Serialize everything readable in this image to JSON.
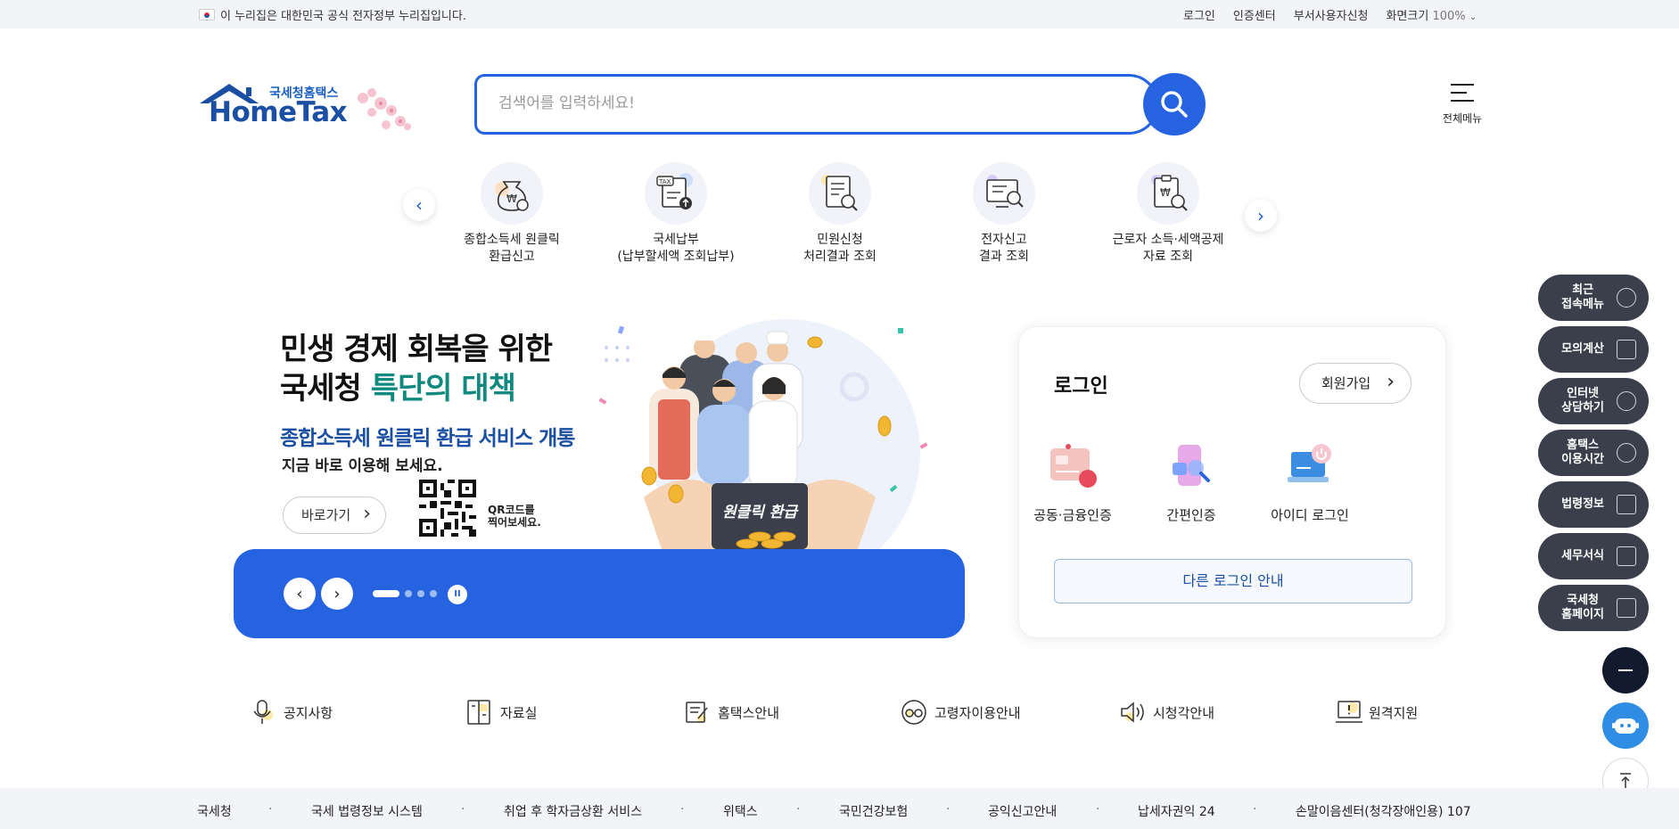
{
  "topbar": {
    "gov_notice": "이 누리집은 대한민국 공식 전자정부 누리집입니다.",
    "links": [
      "로그인",
      "인증센터",
      "부서사용자신청"
    ],
    "zoom_label": "화면크기",
    "zoom_value": "100%"
  },
  "header": {
    "logo_sub": "국세청홈택스",
    "logo_main": "HomeTax",
    "search_placeholder": "검색어를 입력하세요!",
    "menu_label": "전체메뉴"
  },
  "quick_menu": [
    {
      "line1": "종합소득세 원클릭",
      "line2": "환급신고",
      "icon": "money-bag-icon"
    },
    {
      "line1": "국세납부",
      "line2": "(납부할세액 조회납부)",
      "icon": "tax-document-icon"
    },
    {
      "line1": "민원신청",
      "line2": "처리결과 조회",
      "icon": "document-search-icon"
    },
    {
      "line1": "전자신고",
      "line2": "결과 조회",
      "icon": "monitor-search-icon"
    },
    {
      "line1": "근로자 소득·세액공제",
      "line2": "자료 조회",
      "icon": "clipboard-search-icon"
    }
  ],
  "banner": {
    "title_line1": "민생 경제 회복을 위한",
    "title_line2_plain": "국세청 ",
    "title_line2_highlight": "특단의 대책",
    "subtitle": "종합소득세 원클릭 환급 서비스 개통",
    "subtitle2": "지금 바로 이용해 보세요.",
    "go_button": "바로가기",
    "qr_text_line1": "QR코드를",
    "qr_text_line2": "찍어보세요.",
    "sign_text": "원클릭 환급",
    "slide_count": 4,
    "active_slide": 1
  },
  "login": {
    "title": "로그인",
    "join_button": "회원가입",
    "options": [
      "공동·금융인증",
      "간편인증",
      "아이디 로그인"
    ],
    "other_button": "다른 로그인 안내"
  },
  "side_menu": [
    {
      "line1": "최근",
      "line2": "접속메뉴",
      "icon": "clock-icon"
    },
    {
      "line1": "모의계산",
      "line2": "",
      "icon": "calculator-icon"
    },
    {
      "line1": "인터넷",
      "line2": "상담하기",
      "icon": "chat-icon"
    },
    {
      "line1": "홈택스",
      "line2": "이용시간",
      "icon": "alarm-clock-icon"
    },
    {
      "line1": "법령정보",
      "line2": "",
      "icon": "gavel-icon"
    },
    {
      "line1": "세무서식",
      "line2": "",
      "icon": "form-icon"
    },
    {
      "line1": "국세청",
      "line2": "홈페이지",
      "icon": "building-icon"
    }
  ],
  "services": [
    {
      "label": "공지사항",
      "icon": "microphone-icon"
    },
    {
      "label": "자료실",
      "icon": "cabinet-icon"
    },
    {
      "label": "홈택스안내",
      "icon": "note-icon"
    },
    {
      "label": "고령자이용안내",
      "icon": "glasses-icon"
    },
    {
      "label": "시청각안내",
      "icon": "speaker-icon"
    },
    {
      "label": "원격지원",
      "icon": "remote-support-icon"
    }
  ],
  "footer_links": [
    "국세청",
    "국세 법령정보 시스템",
    "취업 후 학자금상환 서비스",
    "위택스",
    "국민건강보험",
    "공익신고안내",
    "납세자권익 24",
    "손말이음센터(청각장애인용) 107"
  ],
  "colors": {
    "primary": "#2563e0",
    "navy": "#1a4fa3",
    "teal": "#12897e",
    "side_button": "#3a3f4b"
  }
}
